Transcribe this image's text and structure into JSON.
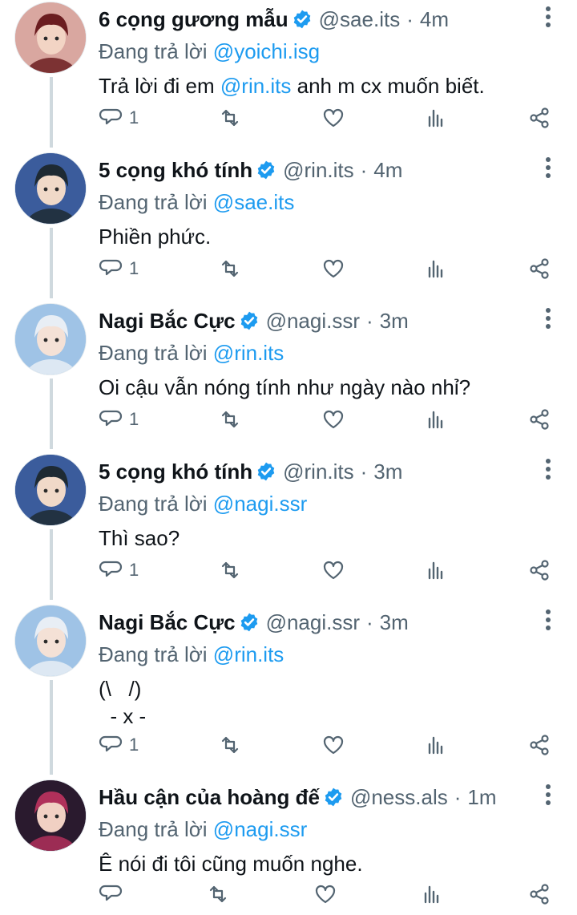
{
  "colors": {
    "accent": "#1d9bf0",
    "muted": "#536471",
    "text": "#0f1419"
  },
  "tweets": [
    {
      "name": "6 cọng gương mẫu",
      "handle": "@sae.its",
      "time": "4m",
      "replying_prefix": "Đang trả lời",
      "replying_to": "@yoichi.isg",
      "body_before": "Trả lời đi em ",
      "body_mention": "@rin.its",
      "body_after": " anh m cx muốn biết.",
      "reply_count": "1",
      "avatar": {
        "bg": "#d9a7a0",
        "hair": "#6b1d20",
        "skin": "#f2d4c4"
      }
    },
    {
      "name": "5 cọng khó tính",
      "handle": "@rin.its",
      "time": "4m",
      "replying_prefix": "Đang trả lời",
      "replying_to": "@sae.its",
      "body_before": "Phiền phức.",
      "body_mention": "",
      "body_after": "",
      "reply_count": "1",
      "avatar": {
        "bg": "#3b5c9c",
        "hair": "#1e2a33",
        "skin": "#f0d9c8"
      }
    },
    {
      "name": "Nagi Bắc Cực",
      "handle": "@nagi.ssr",
      "time": "3m",
      "replying_prefix": "Đang trả lời",
      "replying_to": "@rin.its",
      "body_before": "Oi cậu vẫn nóng tính như ngày nào nhỉ?",
      "body_mention": "",
      "body_after": "",
      "reply_count": "1",
      "avatar": {
        "bg": "#9fc3e6",
        "hair": "#e8eef5",
        "skin": "#f4e1d6"
      }
    },
    {
      "name": "5 cọng khó tính",
      "handle": "@rin.its",
      "time": "3m",
      "replying_prefix": "Đang trả lời",
      "replying_to": "@nagi.ssr",
      "body_before": "Thì sao?",
      "body_mention": "",
      "body_after": "",
      "reply_count": "1",
      "avatar": {
        "bg": "#3b5c9c",
        "hair": "#1e2a33",
        "skin": "#f0d9c8"
      }
    },
    {
      "name": "Nagi Bắc Cực",
      "handle": "@nagi.ssr",
      "time": "3m",
      "replying_prefix": "Đang trả lời",
      "replying_to": "@rin.its",
      "body_before": "(\\   /)\n  - x -",
      "body_mention": "",
      "body_after": "",
      "reply_count": "1",
      "avatar": {
        "bg": "#9fc3e6",
        "hair": "#e8eef5",
        "skin": "#f4e1d6"
      }
    },
    {
      "name": "Hầu cận của hoàng đế",
      "handle": "@ness.als",
      "time": "1m",
      "replying_prefix": "Đang trả lời",
      "replying_to": "@nagi.ssr",
      "body_before": "Ê nói đi tôi cũng muốn nghe.",
      "body_mention": "",
      "body_after": "",
      "reply_count": "",
      "avatar": {
        "bg": "#2a1a2e",
        "hair": "#b0305a",
        "skin": "#f1d0c3"
      }
    }
  ]
}
